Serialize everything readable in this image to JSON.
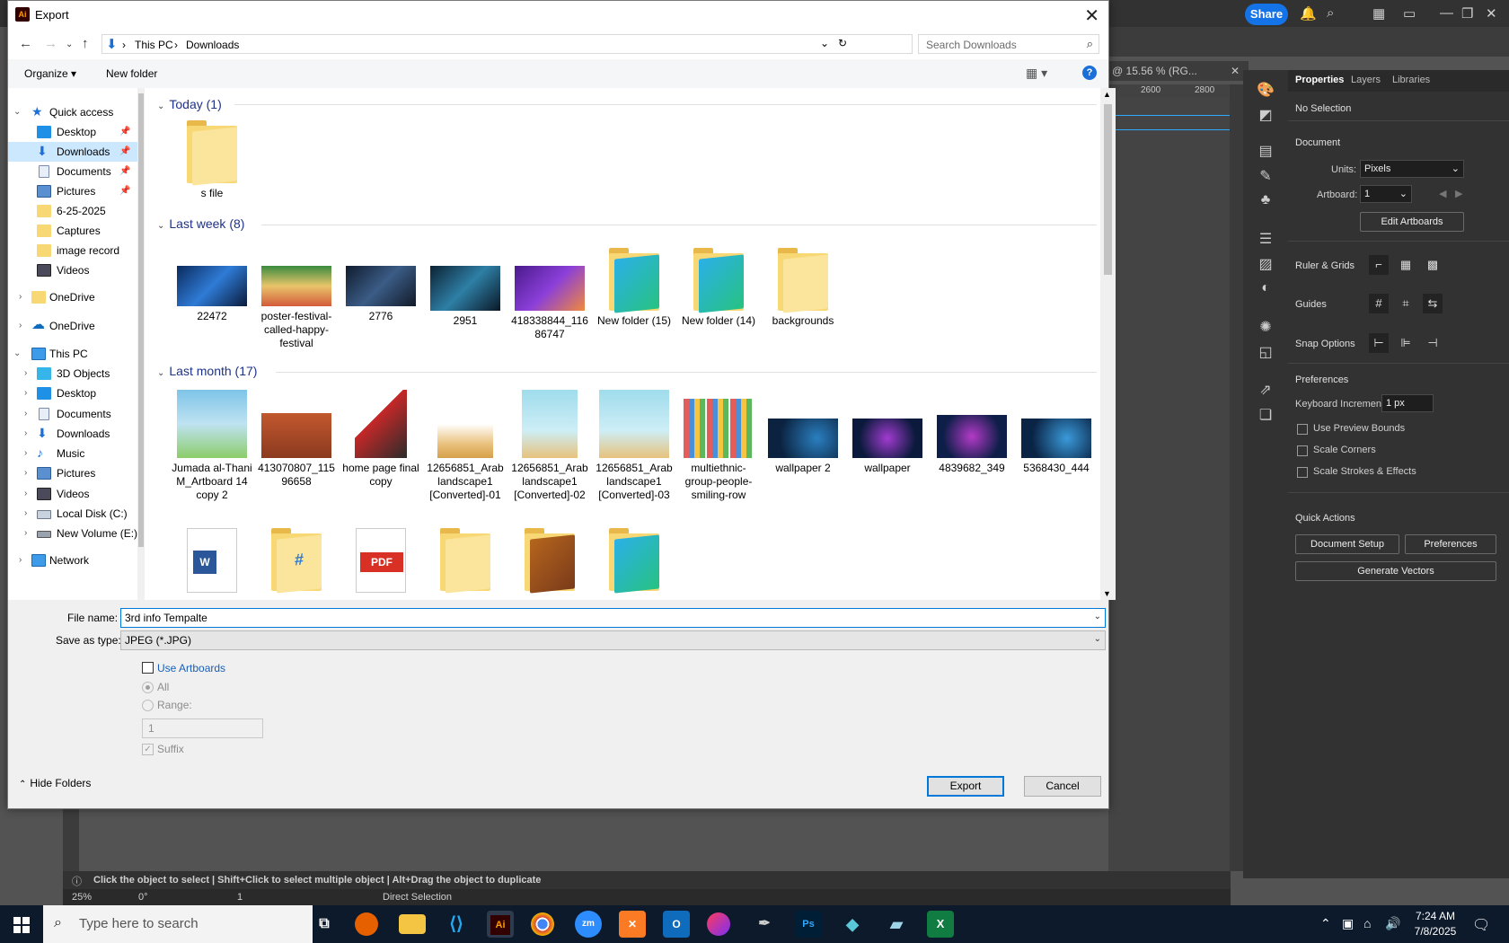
{
  "illustrator": {
    "share_label": "Share",
    "doc_tab": "@ 15.56 % (RG...",
    "ruler_ticks": [
      "2600",
      "2800"
    ],
    "properties_tabs": [
      "Properties",
      "Layers",
      "Libraries"
    ],
    "no_selection": "No Selection",
    "document_header": "Document",
    "units_label": "Units:",
    "units_value": "Pixels",
    "artboard_label": "Artboard:",
    "artboard_value": "1",
    "edit_artboards": "Edit Artboards",
    "ruler_grids": "Ruler & Grids",
    "guides": "Guides",
    "snap_options": "Snap Options",
    "preferences_header": "Preferences",
    "keyboard_increment_label": "Keyboard Increment:",
    "keyboard_increment_value": "1 px",
    "use_preview_bounds": "Use Preview Bounds",
    "scale_corners": "Scale Corners",
    "scale_strokes": "Scale Strokes & Effects",
    "quick_actions": "Quick Actions",
    "document_setup": "Document Setup",
    "preferences_btn": "Preferences",
    "generate_vectors": "Generate Vectors",
    "status_hint": "Click the object to select  |  Shift+Click to select multiple object  |  Alt+Drag the object to duplicate",
    "zoom": "25%",
    "rotate": "0°",
    "artboard_nav": "1",
    "tool_name": "Direct Selection"
  },
  "dialog": {
    "title": "Export",
    "breadcrumb": [
      "This PC",
      "Downloads"
    ],
    "search_placeholder": "Search Downloads",
    "organize": "Organize",
    "new_folder": "New folder",
    "nav": {
      "quick_access": "Quick access",
      "quick_items": [
        "Desktop",
        "Downloads",
        "Documents",
        "Pictures",
        "6-25-2025",
        "Captures",
        "image record",
        "Videos"
      ],
      "onedrive1": "OneDrive",
      "onedrive2": "OneDrive",
      "this_pc": "This PC",
      "pc_items": [
        "3D Objects",
        "Desktop",
        "Documents",
        "Downloads",
        "Music",
        "Pictures",
        "Videos",
        "Local Disk (C:)",
        "New Volume (E:)"
      ],
      "network": "Network"
    },
    "groups": {
      "today": "Today (1)",
      "last_week": "Last week (8)",
      "last_month": "Last month (17)"
    },
    "today_files": [
      "s file"
    ],
    "last_week_files": [
      "22472",
      "poster-festival-called-happy-festival",
      "2776",
      "2951",
      "418338844_11686747",
      "New folder (15)",
      "New folder (14)",
      "backgrounds"
    ],
    "last_month_files": [
      "Jumada al-Thani M_Artboard 14 copy 2",
      "413070807_11596658",
      "home page final copy",
      "12656851_Arab landscape1 [Converted]-01",
      "12656851_Arab landscape1 [Converted]-02",
      "12656851_Arab landscape1 [Converted]-03",
      "multiethnic-group-people-smiling-row",
      "wallpaper 2",
      "wallpaper",
      "4839682_349",
      "5368430_444"
    ],
    "file_name_label": "File name:",
    "file_name_value": "3rd info Tempalte",
    "save_type_label": "Save as type:",
    "save_type_value": "JPEG (*.JPG)",
    "use_artboards": "Use Artboards",
    "all": "All",
    "range": "Range:",
    "range_value": "1",
    "suffix": "Suffix",
    "hide_folders": "Hide Folders",
    "export_btn": "Export",
    "cancel_btn": "Cancel"
  },
  "taskbar": {
    "search_placeholder": "Type here to search",
    "time": "7:24 AM",
    "date": "7/8/2025"
  }
}
